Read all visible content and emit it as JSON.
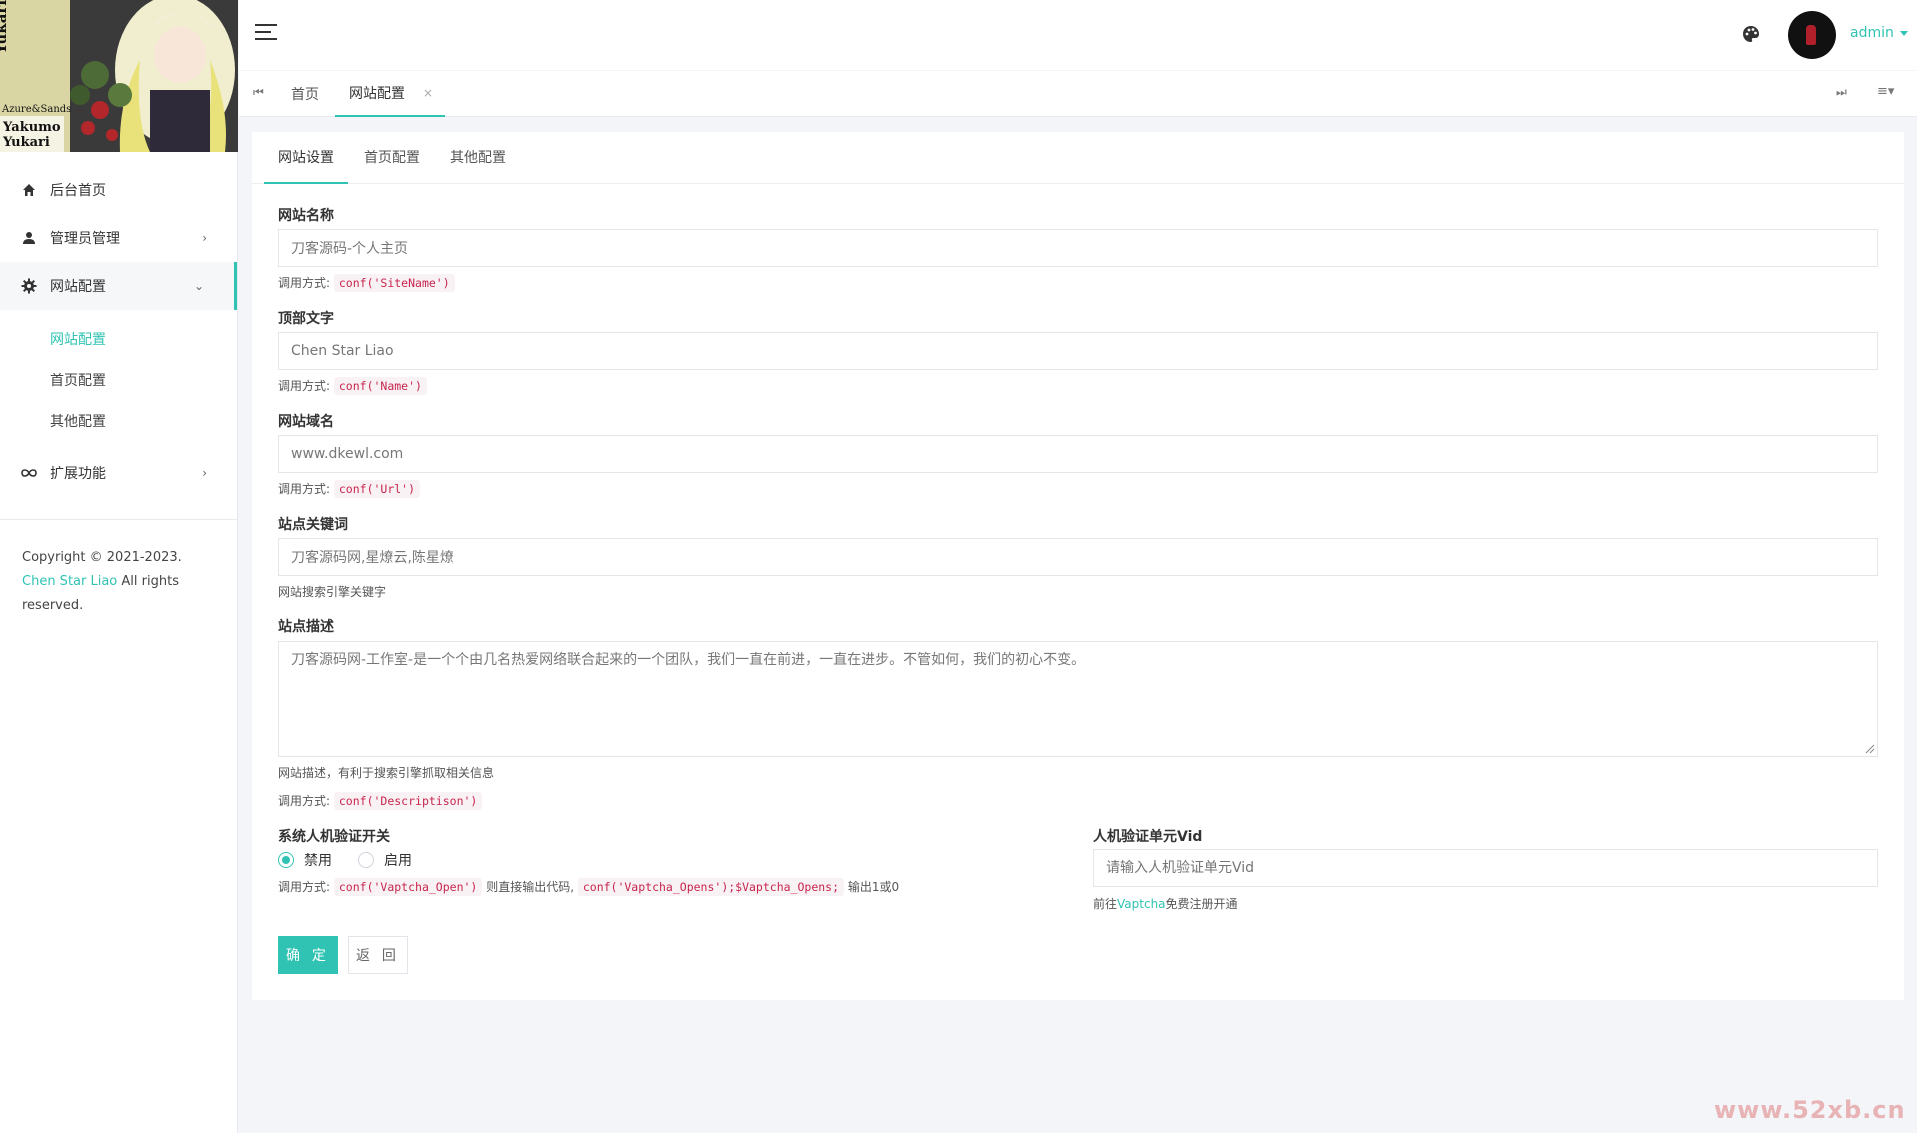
{
  "sidebar": {
    "menu": [
      {
        "label": "后台首页",
        "icon": "home-icon"
      },
      {
        "label": "管理员管理",
        "icon": "user-icon"
      },
      {
        "label": "网站配置",
        "icon": "gear-icon"
      },
      {
        "label": "扩展功能",
        "icon": "infinity-icon"
      }
    ],
    "submenu": [
      "网站配置",
      "首页配置",
      "其他配置"
    ],
    "copyright_prefix": "Copyright © 2021-2023.",
    "copyright_link": "Chen Star Liao",
    "copyright_suffix": "All rights reserved."
  },
  "header": {
    "user": "admin"
  },
  "tabs": {
    "home": "首页",
    "current": "网站配置",
    "close": "×"
  },
  "card": {
    "tabs": [
      "网站设置",
      "首页配置",
      "其他配置"
    ]
  },
  "form": {
    "site_name": {
      "label": "网站名称",
      "value": "刀客源码-个人主页",
      "help_prefix": "调用方式:",
      "code": "conf('SiteName')"
    },
    "top_text": {
      "label": "顶部文字",
      "value": "Chen Star Liao",
      "help_prefix": "调用方式:",
      "code": "conf('Name')"
    },
    "domain": {
      "label": "网站域名",
      "value": "www.dkewl.com",
      "help_prefix": "调用方式:",
      "code": "conf('Url')"
    },
    "keywords": {
      "label": "站点关键词",
      "value": "刀客源码网,星燎云,陈星燎",
      "help": "网站搜索引擎关键字"
    },
    "description": {
      "label": "站点描述",
      "value": "刀客源码网-工作室-是一个个由几名热爱网络联合起来的一个团队，我们一直在前进，一直在进步。不管如何，我们的初心不变。",
      "help": "网站描述，有利于搜索引擎抓取相关信息",
      "help_prefix": "调用方式:",
      "code": "conf('Descriptison')"
    },
    "captcha": {
      "label": "系统人机验证开关",
      "options": [
        "禁用",
        "启用"
      ],
      "selected": "禁用",
      "help_prefix": "调用方式:",
      "code1": "conf('Vaptcha_Open')",
      "mid": "则直接输出代码,",
      "code2": "conf('Vaptcha_Opens');$Vaptcha_Opens;",
      "suffix": "输出1或0"
    },
    "vid": {
      "label": "人机验证单元Vid",
      "placeholder": "请输入人机验证单元Vid",
      "help_prefix": "前往",
      "help_link": "Vaptcha",
      "help_suffix": "免费注册开通"
    },
    "confirm": "确 定",
    "back": "返 回"
  },
  "watermark": "www.52xb.cn",
  "colors": {
    "accent": "#30c3b3",
    "code": "#c7254e",
    "background": "#f3f5f8"
  }
}
